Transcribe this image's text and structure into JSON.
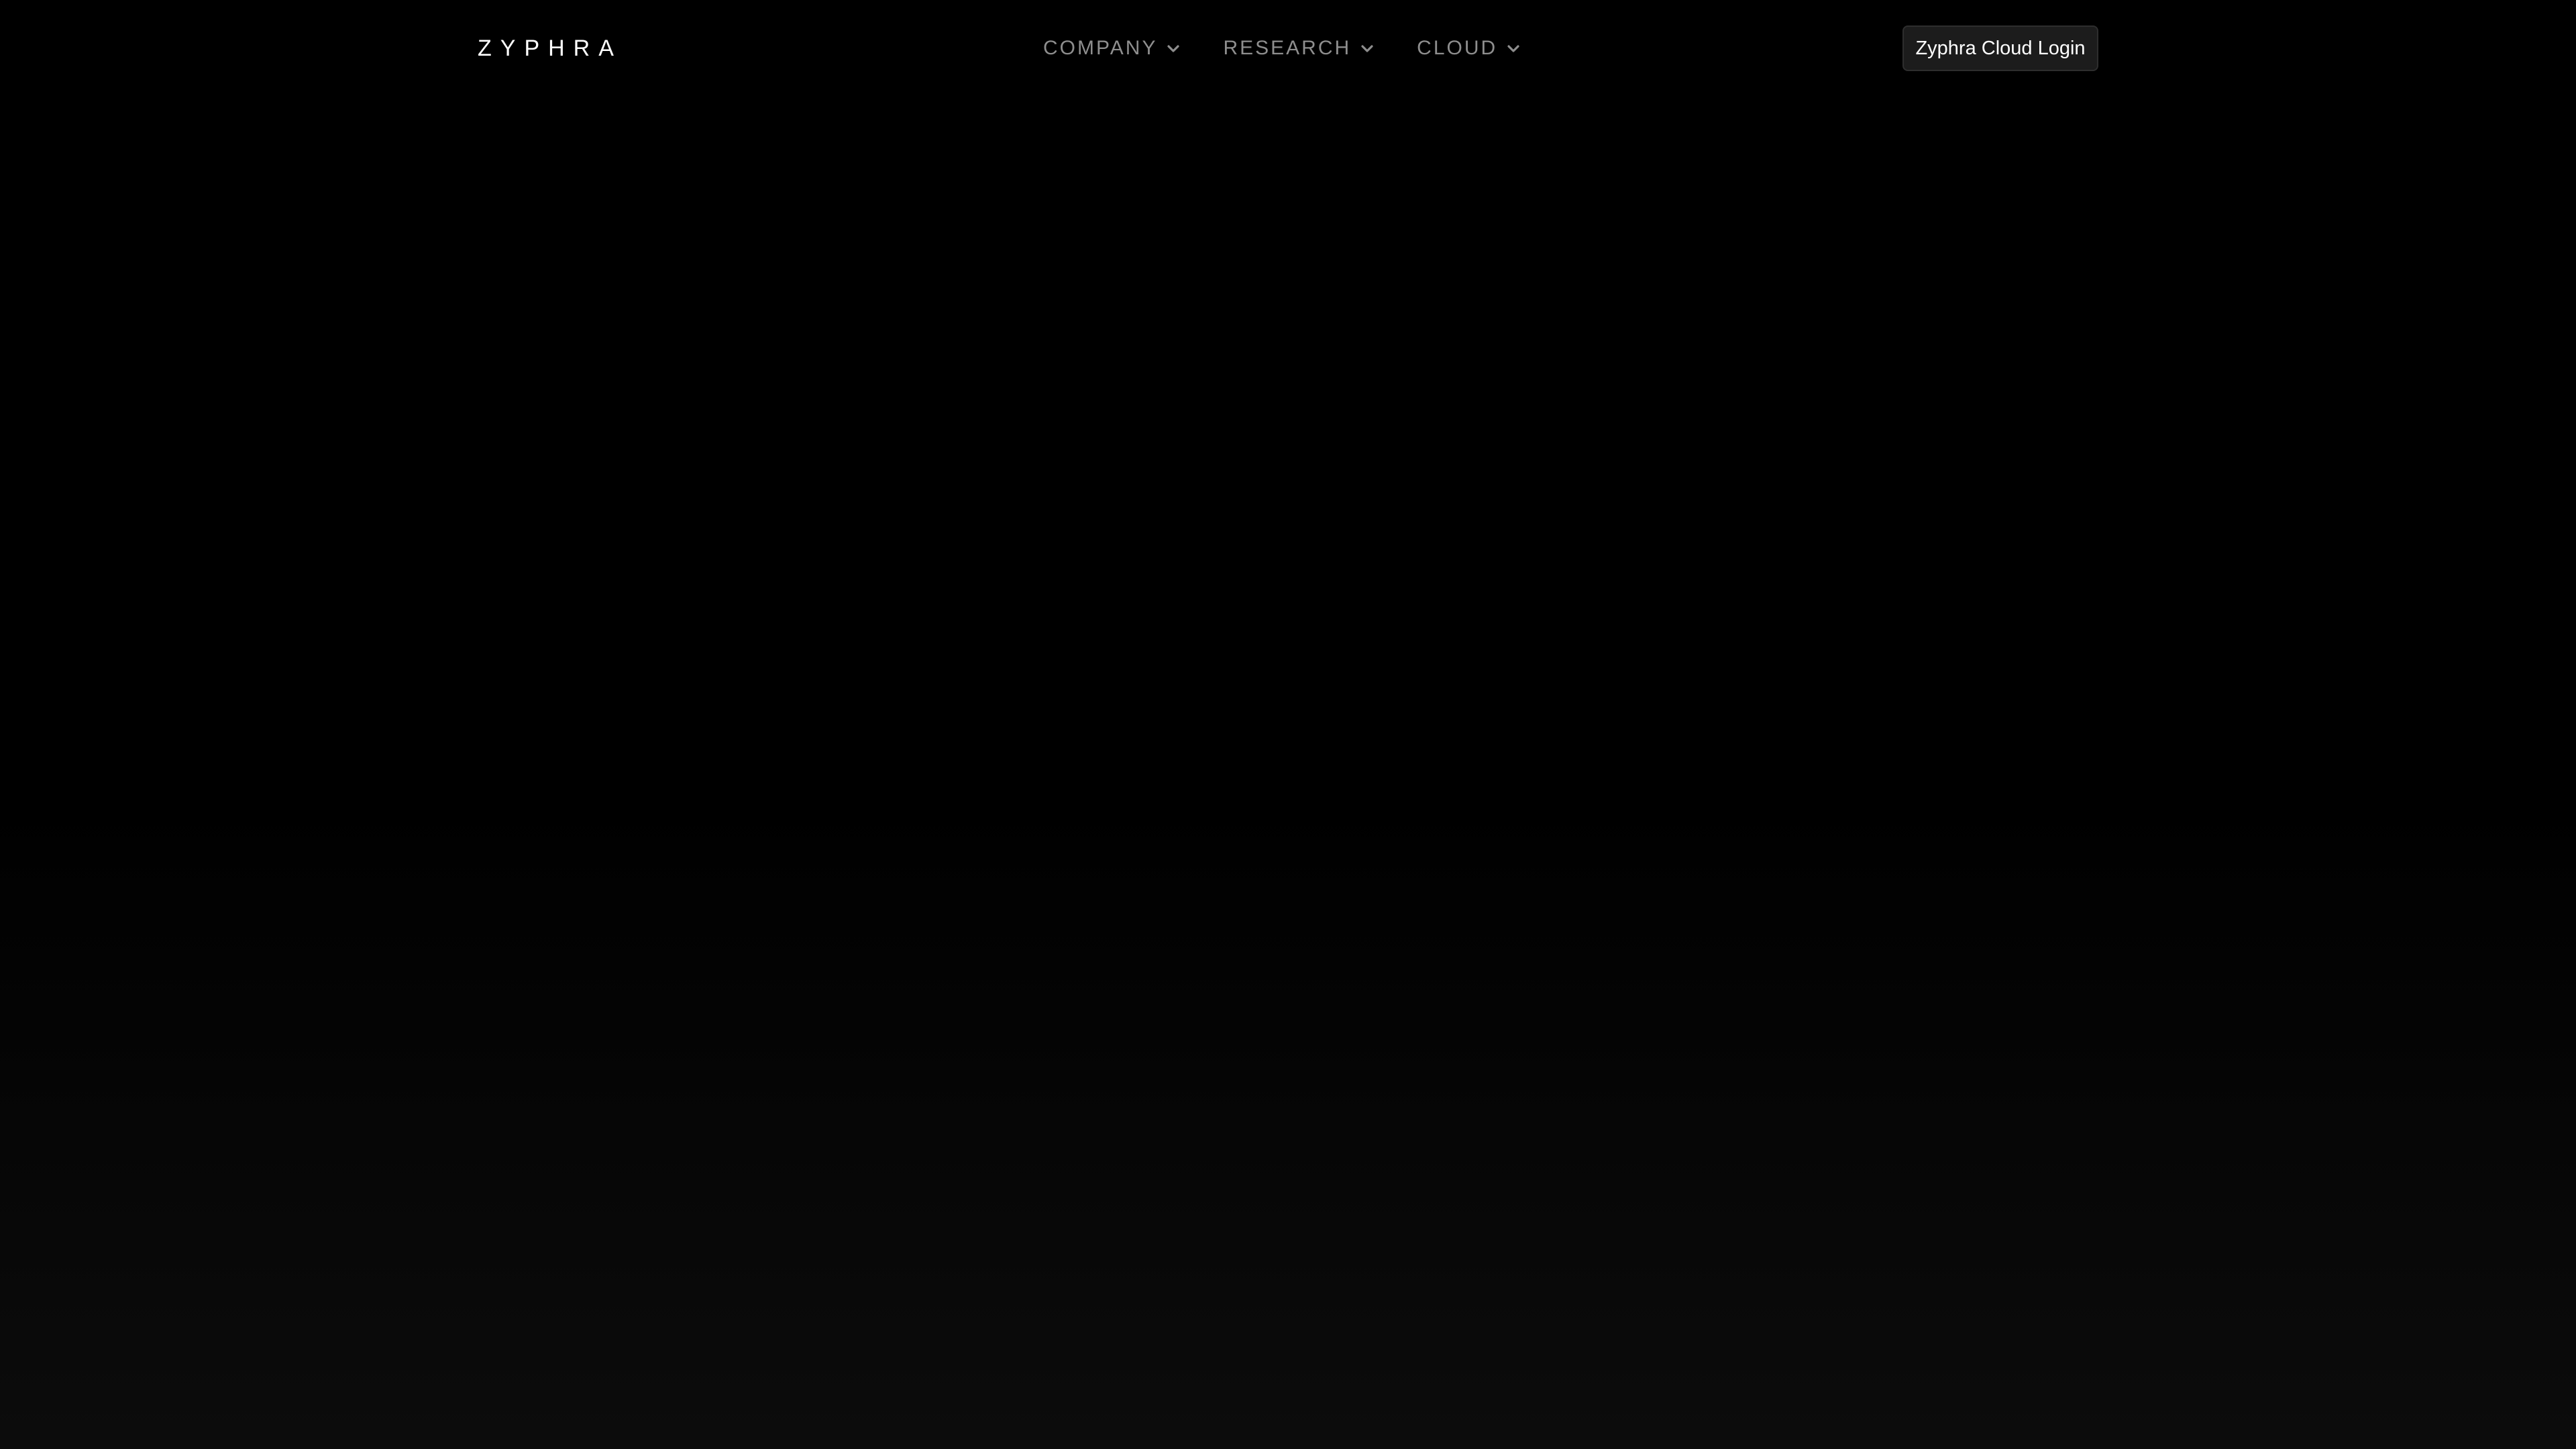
{
  "header": {
    "logo": "ZYPHRA",
    "nav": [
      {
        "label": "COMPANY"
      },
      {
        "label": "RESEARCH"
      },
      {
        "label": "CLOUD"
      }
    ],
    "login_label": "Zyphra Cloud Login"
  },
  "colors": {
    "background": "#000000",
    "nav_text": "#8e8e8e",
    "button_bg": "#1c1c1c",
    "button_text": "#ffffff"
  },
  "icons": {
    "nav_dropdown": "chevron-down-icon"
  }
}
